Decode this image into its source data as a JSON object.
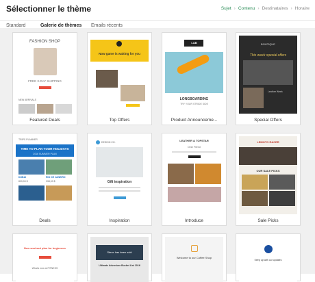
{
  "header": {
    "title": "Sélectionner le thème",
    "steps": [
      "Sujet",
      "Contenu",
      "Destinataires",
      "Horaire"
    ]
  },
  "tabs": [
    "Standard",
    "Galerie de thèmes",
    "Emails récents"
  ],
  "cards": [
    {
      "label": "Featured Deals",
      "thumb_title": "FASHION SHOP",
      "thumb_sub": "FREE 3-DAY SHIPPING",
      "thumb_extra": "NEW ARRIVALS"
    },
    {
      "label": "Top Offers",
      "thumb_title": "Now game is waiting for you"
    },
    {
      "label": "Product Announceme...",
      "thumb_title": "LONGBOARDING",
      "thumb_sub": "TRY YOUR STRIDE SIDE",
      "logo": "L&B"
    },
    {
      "label": "Special Offers",
      "thumb_title": "This week special offers",
      "thumb_sub": "Leather Week",
      "logo": "BOUTIQUE"
    },
    {
      "label": "Deals",
      "thumb_title": "TIME TO PLAN YOUR HOLIDAYS",
      "thumb_sub": "2016 SUMMER PLAN",
      "logo": "TRIPS PLANNER",
      "dest1": "DUBAI",
      "dest2": "RIO DE JANEIRO",
      "price1": "899,00 $",
      "price2": "998,00 $"
    },
    {
      "label": "Inspiration",
      "thumb_title": "Gift inspiration",
      "logo": "DESIGN CO."
    },
    {
      "label": "Introduce",
      "thumb_title": "LEATHER & TOPSTAR",
      "thumb_sub": "Dear Friend"
    },
    {
      "label": "Sale Picks",
      "thumb_title": "OUR SALE PICKS",
      "logo": "LEMOTO RACER"
    },
    {
      "label": "",
      "thumb_title": "New workout plan for beginners",
      "thumb_sub": "What's new at FITNESS"
    },
    {
      "label": "",
      "thumb_title": "Steve has been sold",
      "thumb_sub": "Ultimate Adventure Bucket List 2016"
    },
    {
      "label": "",
      "thumb_title": "Welcome to our Coffee Shop"
    },
    {
      "label": "",
      "thumb_title": "Keep up with our updates"
    }
  ]
}
